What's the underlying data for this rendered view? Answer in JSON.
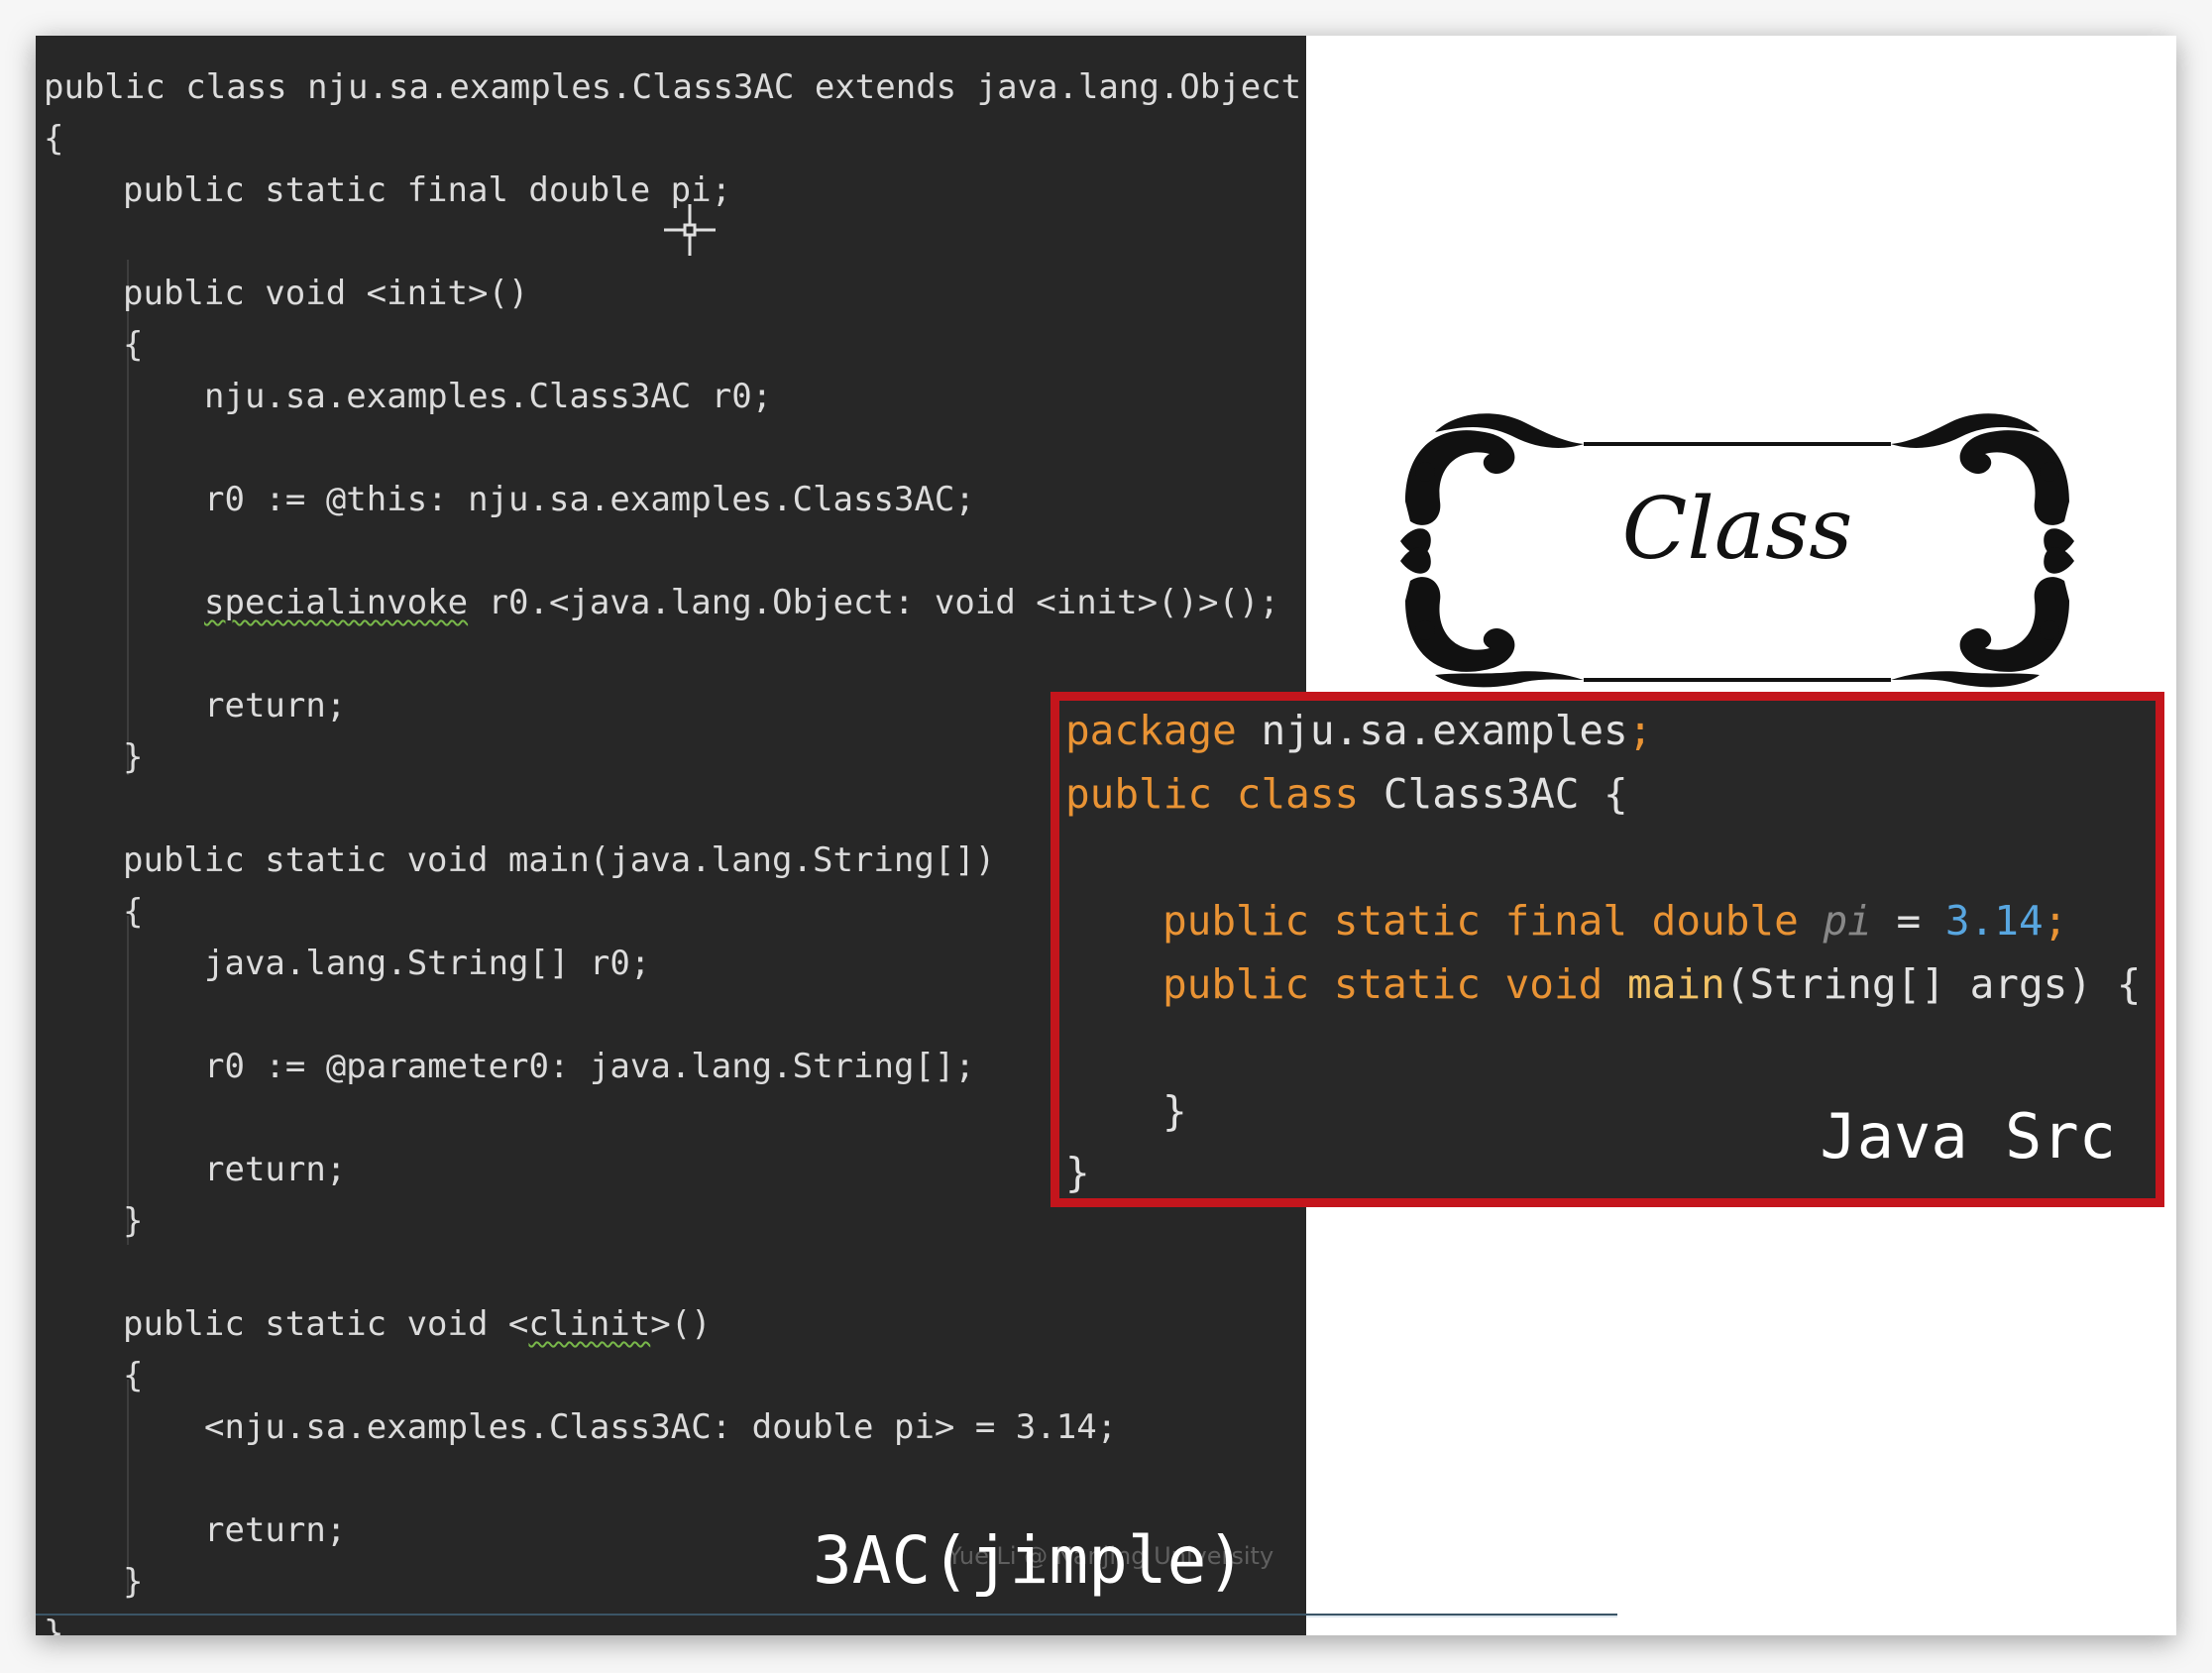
{
  "jimple": {
    "lines": [
      "public class nju.sa.examples.Class3AC extends java.lang.Object",
      "{",
      "public static final double pi;",
      "public void <init>()",
      "{",
      "nju.sa.examples.Class3AC r0;",
      "r0 := @this: nju.sa.examples.Class3AC;",
      "specialinvoke",
      " r0.<java.lang.Object: void <init>()>();",
      "return;",
      "}",
      "public static void main(java.lang.String[])",
      "{",
      "java.lang.String[] r0;",
      "r0 := @parameter0: java.lang.String[];",
      "return;",
      "}",
      "public static void <",
      "clinit",
      ">()",
      "{",
      "<nju.sa.examples.Class3AC: double pi> = 3.14;",
      "return;",
      "}",
      "}"
    ],
    "caption": "3AC(jimple)",
    "watermark": "Yue Li @ Nanjing University"
  },
  "class_frame": {
    "title": "Class"
  },
  "java_src": {
    "kw_package": "package",
    "pkg_name": " nju.sa.examples",
    "semi": ";",
    "kw_public_class": "public class",
    "class_name": " Class3AC {",
    "kw_field": "public static final double",
    "field_name": "pi",
    "assign": " = ",
    "field_value": "3.14",
    "kw_method": "public static void",
    "method_name": "main",
    "params": "(String[] args) {",
    "inner_close": "}",
    "outer_close": "}",
    "caption": "Java Src"
  },
  "colors": {
    "jimple_bg": "#272727",
    "java_bg": "#282828",
    "highlight_border": "#c4151c",
    "keyword": "#e99334",
    "method": "#f2c265",
    "number": "#58a6e0"
  }
}
